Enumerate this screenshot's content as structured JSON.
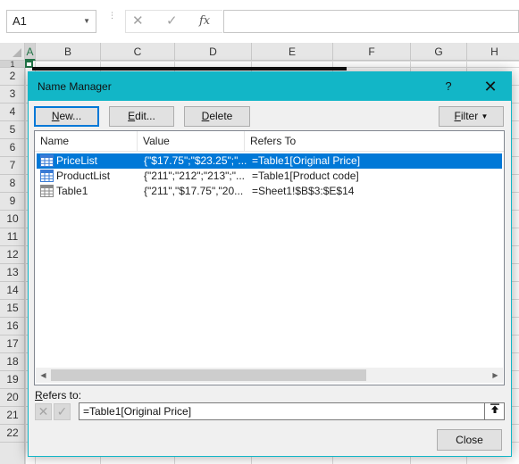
{
  "excel": {
    "name_box": "A1",
    "formula_buttons": {
      "cancel": "✕",
      "enter": "✓",
      "fx": "fx"
    },
    "columns": [
      "A",
      "B",
      "C",
      "D",
      "E",
      "F",
      "G",
      "H"
    ],
    "rows": [
      "1",
      "2",
      "3",
      "4",
      "5",
      "6",
      "7",
      "8",
      "9",
      "10",
      "11",
      "12",
      "13",
      "14",
      "15",
      "16",
      "17",
      "18",
      "19",
      "20",
      "21",
      "22"
    ]
  },
  "dialog": {
    "title": "Name Manager",
    "help": "?",
    "close_glyph": "✕",
    "buttons": {
      "new_label": "New...",
      "edit_label": "Edit...",
      "delete_label": "Delete",
      "filter_label": "Filter",
      "close_label": "Close"
    },
    "columns": [
      "Name",
      "Value",
      "Refers To"
    ],
    "names": [
      {
        "name": "PriceList",
        "value": "{\"$17.75\";\"$23.25\";\"...",
        "refers_to": "=Table1[Original Price]",
        "selected": true,
        "icon": "named-range-icon"
      },
      {
        "name": "ProductList",
        "value": "{\"211\";\"212\";\"213\";\"...",
        "refers_to": "=Table1[Product code]",
        "selected": false,
        "icon": "named-range-icon"
      },
      {
        "name": "Table1",
        "value": "{\"211\",\"$17.75\",\"20...",
        "refers_to": "=Sheet1!$B$3:$E$14",
        "selected": false,
        "icon": "table-icon"
      }
    ],
    "refers_to_label": "Refers to:",
    "refers_to_value": "=Table1[Original Price]",
    "accent": "#12b6c7",
    "selection": "#0078d7"
  }
}
